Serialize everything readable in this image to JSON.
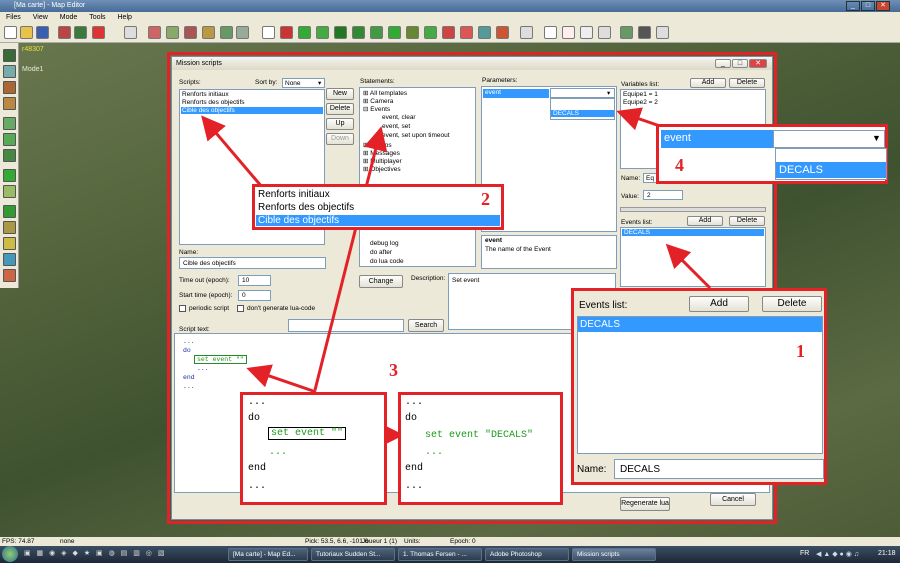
{
  "window": {
    "title": "[Ma carte] - Map Editor"
  },
  "menu": [
    "Files",
    "View",
    "Mode",
    "Tools",
    "Help"
  ],
  "viewport": {
    "coords": "r48307",
    "mode": "Mode1"
  },
  "dialog": {
    "title": "Mission scripts",
    "scripts_label": "Scripts:",
    "sort_label": "Sort by:",
    "sort_value": "None",
    "scripts": [
      "Renforts initiaux",
      "Renforts des objectifs",
      "Cible des objectifs"
    ],
    "buttons": {
      "new": "New",
      "delete": "Delete",
      "up": "Up",
      "down": "Down",
      "change": "Change",
      "search": "Search",
      "add": "Add",
      "regenerate": "Regenerate lua",
      "cancel": "Cancel"
    },
    "statements_label": "Statements:",
    "statements": [
      "All templates",
      "Camera",
      "Events",
      "event, clear",
      "event, set",
      "event, set upon timeout",
      "Groups",
      "Messages",
      "Multiplayer",
      "Objectives",
      "debug log",
      "do after",
      "do lua code"
    ],
    "parameters_label": "Parameters:",
    "param_event": "event",
    "param_dropdown_option": "DECALS",
    "variables_label": "Variables list:",
    "variables": [
      "Equipe1 = 1",
      "Equipe2 = 2"
    ],
    "var_name_label": "Name:",
    "var_name_value": "Eq",
    "var_value_label": "Value:",
    "var_value_value": "2",
    "events_label": "Events list:",
    "events": [
      "DECALS"
    ],
    "param_desc_title": "event",
    "param_desc_text": "The name of the Event",
    "name_label": "Name:",
    "name_value": "Cible des objectifs",
    "timeout_label": "Time out (epoch):",
    "timeout_value": "10",
    "starttime_label": "Start time (epoch):",
    "starttime_value": "0",
    "periodic_label": "periodic script",
    "nolua_label": "don't generate lua-code",
    "description_label": "Description:",
    "description_value": "Set event",
    "scripttext_label": "Script text:",
    "script_lines": [
      "...",
      "do",
      "set event \"\"",
      "...",
      "end",
      "..."
    ]
  },
  "callouts": {
    "c1": {
      "number": "1",
      "events_label": "Events list:",
      "add": "Add",
      "delete": "Delete",
      "item": "DECALS",
      "name_label": "Name:",
      "name_value": "DECALS"
    },
    "c2": {
      "number": "2",
      "items": [
        "Renforts initiaux",
        "Renforts des objectifs",
        "Cible des objectifs"
      ]
    },
    "c3": {
      "number": "3",
      "before": [
        "...",
        "do",
        "set event \"\"",
        "...",
        "end",
        "..."
      ],
      "after": [
        "...",
        "do",
        "set event \"DECALS\"",
        "...",
        "end",
        "..."
      ]
    },
    "c4": {
      "number": "4",
      "field": "event",
      "option": "DECALS"
    }
  },
  "status": {
    "fps": "FPS: 74.87",
    "sel": "none",
    "pick": "Pick: 53.5, 6.6, -101.6",
    "player": "Joueur 1 (1)",
    "units": "Units:",
    "epoch": "Epoch: 0"
  },
  "taskbar": {
    "tasks": [
      "[Ma carte] - Map Ed...",
      "Tutoriaux Sudden St...",
      "1. Thomas Fersen - ...",
      "Adobe Photoshop",
      "Mission scripts"
    ],
    "lang": "FR",
    "clock": "21:18"
  },
  "colors": {
    "accent": "#e32228",
    "selection": "#3399ff"
  }
}
